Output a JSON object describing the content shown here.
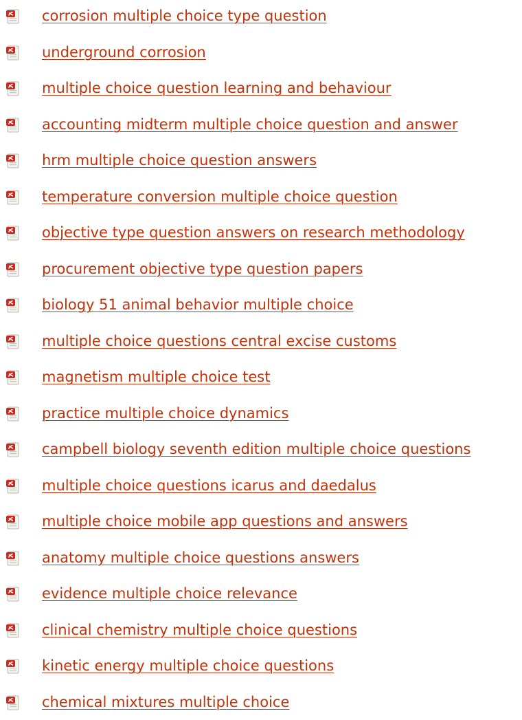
{
  "colors": {
    "link": "#c1330a",
    "icon_red": "#d0281c",
    "icon_paper": "#f3f3ee"
  },
  "icon": "pdf-file-icon",
  "links": [
    {
      "label": "corrosion multiple choice type question"
    },
    {
      "label": "underground corrosion"
    },
    {
      "label": "multiple choice question learning and behaviour"
    },
    {
      "label": "accounting midterm multiple choice question and answer"
    },
    {
      "label": "hrm multiple choice question answers"
    },
    {
      "label": "temperature conversion multiple choice question"
    },
    {
      "label": "objective type question answers on research methodology"
    },
    {
      "label": "procurement objective type question papers"
    },
    {
      "label": "biology 51 animal behavior multiple choice"
    },
    {
      "label": "multiple choice questions central excise customs"
    },
    {
      "label": "magnetism multiple choice test"
    },
    {
      "label": "practice multiple choice dynamics"
    },
    {
      "label": "campbell biology seventh edition multiple choice questions"
    },
    {
      "label": "multiple choice questions icarus and daedalus"
    },
    {
      "label": "multiple choice mobile app questions and answers"
    },
    {
      "label": "anatomy multiple choice questions answers"
    },
    {
      "label": "evidence multiple choice relevance"
    },
    {
      "label": "clinical chemistry multiple choice questions"
    },
    {
      "label": "kinetic energy multiple choice questions"
    },
    {
      "label": "chemical mixtures multiple choice"
    }
  ]
}
